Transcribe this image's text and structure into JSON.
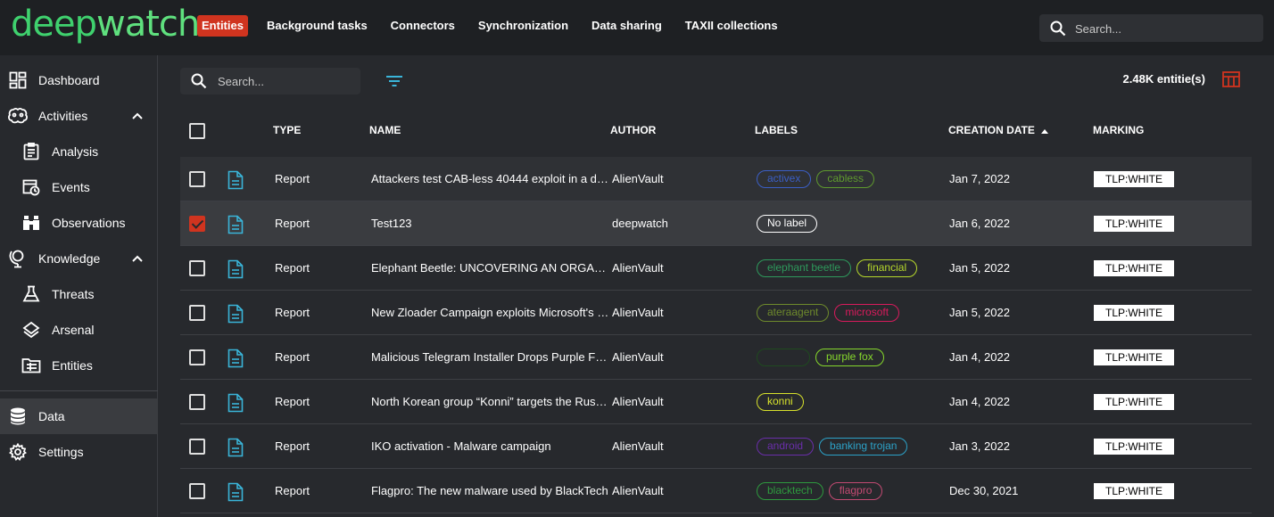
{
  "app": {
    "logo_text": "deepwatch"
  },
  "topnav": {
    "items": [
      {
        "label": "Entities",
        "active": true
      },
      {
        "label": "Background tasks",
        "active": false
      },
      {
        "label": "Connectors",
        "active": false
      },
      {
        "label": "Synchronization",
        "active": false
      },
      {
        "label": "Data sharing",
        "active": false
      },
      {
        "label": "TAXII collections",
        "active": false
      }
    ],
    "search_placeholder": "Search...",
    "accent_color": "#d0341f"
  },
  "sidebar": {
    "items": [
      {
        "label": "Dashboard",
        "icon": "dashboard-icon",
        "level": 0
      },
      {
        "label": "Activities",
        "icon": "brain-icon",
        "level": 0,
        "expanded": true
      },
      {
        "label": "Analysis",
        "icon": "clipboard-icon",
        "level": 1
      },
      {
        "label": "Events",
        "icon": "calendar-clock-icon",
        "level": 1
      },
      {
        "label": "Observations",
        "icon": "binoculars-icon",
        "level": 1
      },
      {
        "label": "Knowledge",
        "icon": "globe-stand-icon",
        "level": 0,
        "expanded": true
      },
      {
        "label": "Threats",
        "icon": "flask-icon",
        "level": 1
      },
      {
        "label": "Arsenal",
        "icon": "layers-icon",
        "level": 1
      },
      {
        "label": "Entities",
        "icon": "folder-table-icon",
        "level": 1
      },
      {
        "label": "Data",
        "icon": "database-icon",
        "level": 0,
        "selected": true
      },
      {
        "label": "Settings",
        "icon": "gear-icon",
        "level": 0
      }
    ]
  },
  "main": {
    "search_placeholder": "Search...",
    "entity_count": "2.48K entitie(s)",
    "columns": {
      "type": "TYPE",
      "name": "NAME",
      "author": "AUTHOR",
      "labels": "LABELS",
      "creation_date": "CREATION DATE",
      "marking": "MARKING"
    },
    "sort": {
      "column": "creation_date",
      "direction": "ascending-arrow"
    },
    "rows": [
      {
        "type": "Report",
        "name": "Attackers test CAB-less 40444 exploit in a d…",
        "author": "AlienVault",
        "labels": [
          {
            "text": "activex",
            "color": "#3b5fc6"
          },
          {
            "text": "cabless",
            "color": "#5f9a2e"
          }
        ],
        "date": "Jan 7, 2022",
        "marking": "TLP:WHITE",
        "checked": false
      },
      {
        "type": "Report",
        "name": "Test123",
        "author": "deepwatch",
        "labels": [
          {
            "text": "No label",
            "color": "#ffffff"
          }
        ],
        "date": "Jan 6, 2022",
        "marking": "TLP:WHITE",
        "checked": true
      },
      {
        "type": "Report",
        "name": "Elephant Beetle: UNCOVERING AN ORGANIZ…",
        "author": "AlienVault",
        "labels": [
          {
            "text": "elephant beetle",
            "color": "#2e9a5c"
          },
          {
            "text": "financial",
            "color": "#b6d82c"
          }
        ],
        "date": "Jan 5, 2022",
        "marking": "TLP:WHITE",
        "checked": false
      },
      {
        "type": "Report",
        "name": "New Zloader Campaign exploits Microsoft's …",
        "author": "AlienVault",
        "labels": [
          {
            "text": "ateraagent",
            "color": "#6e8a2c"
          },
          {
            "text": "microsoft",
            "color": "#d81b5c"
          }
        ],
        "date": "Jan 5, 2022",
        "marking": "TLP:WHITE",
        "checked": false
      },
      {
        "type": "Report",
        "name": "Malicious Telegram Installer Drops Purple F…",
        "author": "AlienVault",
        "labels": [
          {
            "text": "",
            "color": "#1f4a1f"
          },
          {
            "text": "purple fox",
            "color": "#86d82c"
          }
        ],
        "date": "Jan 4, 2022",
        "marking": "TLP:WHITE",
        "checked": false
      },
      {
        "type": "Report",
        "name": "North Korean group “Konni” targets the Rus…",
        "author": "AlienVault",
        "labels": [
          {
            "text": "konni",
            "color": "#d8e22c"
          }
        ],
        "date": "Jan 4, 2022",
        "marking": "TLP:WHITE",
        "checked": false
      },
      {
        "type": "Report",
        "name": "IKO activation - Malware campaign",
        "author": "AlienVault",
        "labels": [
          {
            "text": "android",
            "color": "#6a2eaa"
          },
          {
            "text": "banking trojan",
            "color": "#2ca2c8"
          }
        ],
        "date": "Jan 3, 2022",
        "marking": "TLP:WHITE",
        "checked": false
      },
      {
        "type": "Report",
        "name": "Flagpro: The new malware used by BlackTech",
        "author": "AlienVault",
        "labels": [
          {
            "text": "blacktech",
            "color": "#2e9a3e"
          },
          {
            "text": "flagpro",
            "color": "#c24a72"
          }
        ],
        "date": "Dec 30, 2021",
        "marking": "TLP:WHITE",
        "checked": false
      }
    ]
  }
}
